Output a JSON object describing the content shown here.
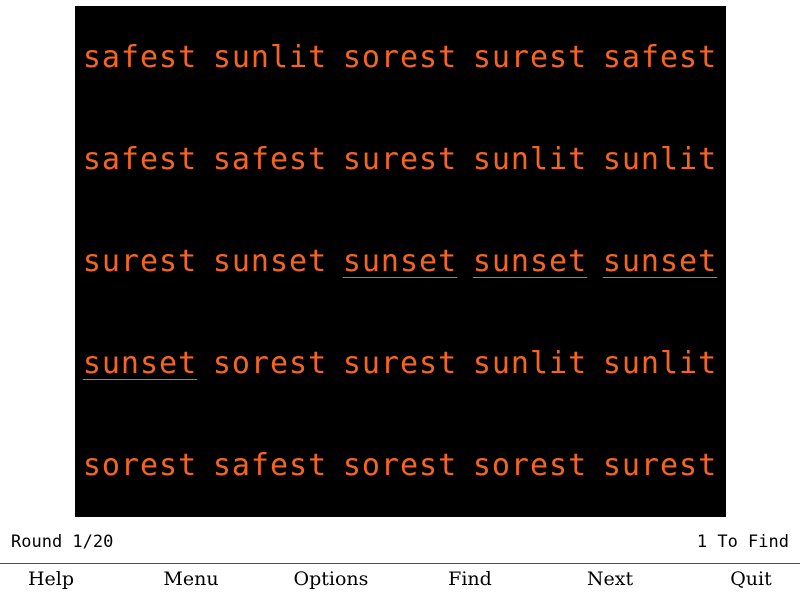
{
  "board": {
    "background_color": "#000000",
    "word_color": "#f26522",
    "rows": [
      [
        {
          "text": "safest",
          "found": false
        },
        {
          "text": "sunlit",
          "found": false
        },
        {
          "text": "sorest",
          "found": false
        },
        {
          "text": "surest",
          "found": false
        },
        {
          "text": "safest",
          "found": false
        }
      ],
      [
        {
          "text": "safest",
          "found": false
        },
        {
          "text": "safest",
          "found": false
        },
        {
          "text": "surest",
          "found": false
        },
        {
          "text": "sunlit",
          "found": false
        },
        {
          "text": "sunlit",
          "found": false
        }
      ],
      [
        {
          "text": "surest",
          "found": false
        },
        {
          "text": "sunset",
          "found": false
        },
        {
          "text": "sunset",
          "found": true
        },
        {
          "text": "sunset",
          "found": true
        },
        {
          "text": "sunset",
          "found": true
        }
      ],
      [
        {
          "text": "sunset",
          "found": true
        },
        {
          "text": "sorest",
          "found": false
        },
        {
          "text": "surest",
          "found": false
        },
        {
          "text": "sunlit",
          "found": false
        },
        {
          "text": "sunlit",
          "found": false
        }
      ],
      [
        {
          "text": "sorest",
          "found": false
        },
        {
          "text": "safest",
          "found": false
        },
        {
          "text": "sorest",
          "found": false
        },
        {
          "text": "sorest",
          "found": false
        },
        {
          "text": "surest",
          "found": false
        }
      ]
    ]
  },
  "status": {
    "round": "Round 1/20",
    "to_find": "1 To Find"
  },
  "menu": {
    "items": [
      {
        "id": "help",
        "label": "Help"
      },
      {
        "id": "menu",
        "label": "Menu"
      },
      {
        "id": "options",
        "label": "Options"
      },
      {
        "id": "find",
        "label": "Find"
      },
      {
        "id": "next",
        "label": "Next"
      },
      {
        "id": "quit",
        "label": "Quit"
      }
    ]
  }
}
